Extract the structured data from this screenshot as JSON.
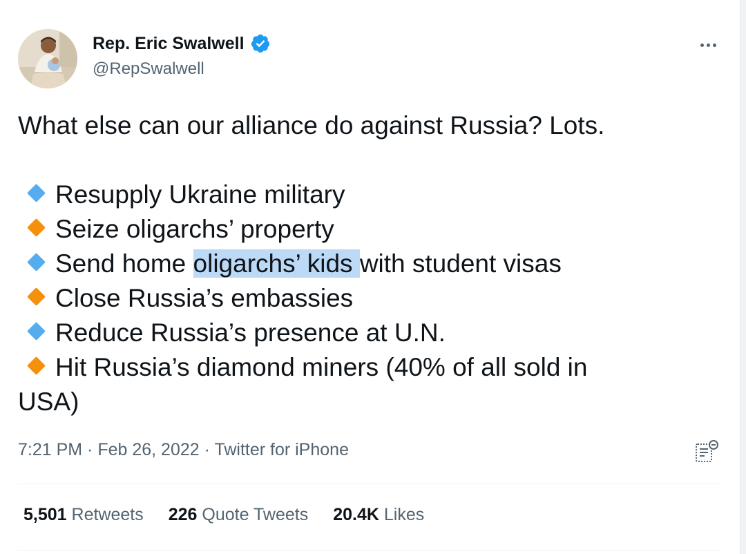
{
  "author": {
    "display_name": "Rep. Eric Swalwell",
    "handle": "@RepSwalwell",
    "verified": true
  },
  "tweet": {
    "intro": "What else can our alliance do against Russia? Lots.",
    "items": [
      {
        "bullet": "blue-diamond",
        "text": "Resupply Ukraine military"
      },
      {
        "bullet": "orange-diamond",
        "text": "Seize oligarchs’ property"
      },
      {
        "bullet": "blue-diamond",
        "text_before": "Send home ",
        "text_highlight": "oligarchs’ kids ",
        "text_after": "with student visas"
      },
      {
        "bullet": "orange-diamond",
        "text": "Close Russia’s embassies"
      },
      {
        "bullet": "blue-diamond",
        "text": "Reduce Russia’s presence at U.N."
      },
      {
        "bullet": "orange-diamond",
        "text_line1": "Hit Russia’s diamond miners (40% of all sold in",
        "text_line2": "USA)"
      }
    ],
    "time": "7:21 PM",
    "separator": " · ",
    "date": "Feb 26, 2022",
    "source": "Twitter for iPhone"
  },
  "stats": {
    "retweets_count": "5,501",
    "retweets_label": "Retweets",
    "quotes_count": "226",
    "quotes_label": "Quote Tweets",
    "likes_count": "20.4K",
    "likes_label": "Likes"
  },
  "colors": {
    "blue_diamond": "#55acee",
    "orange_diamond": "#f4900c",
    "verified": "#1d9bf0",
    "highlight": "#bcd9f6",
    "secondary_text": "#536471"
  }
}
